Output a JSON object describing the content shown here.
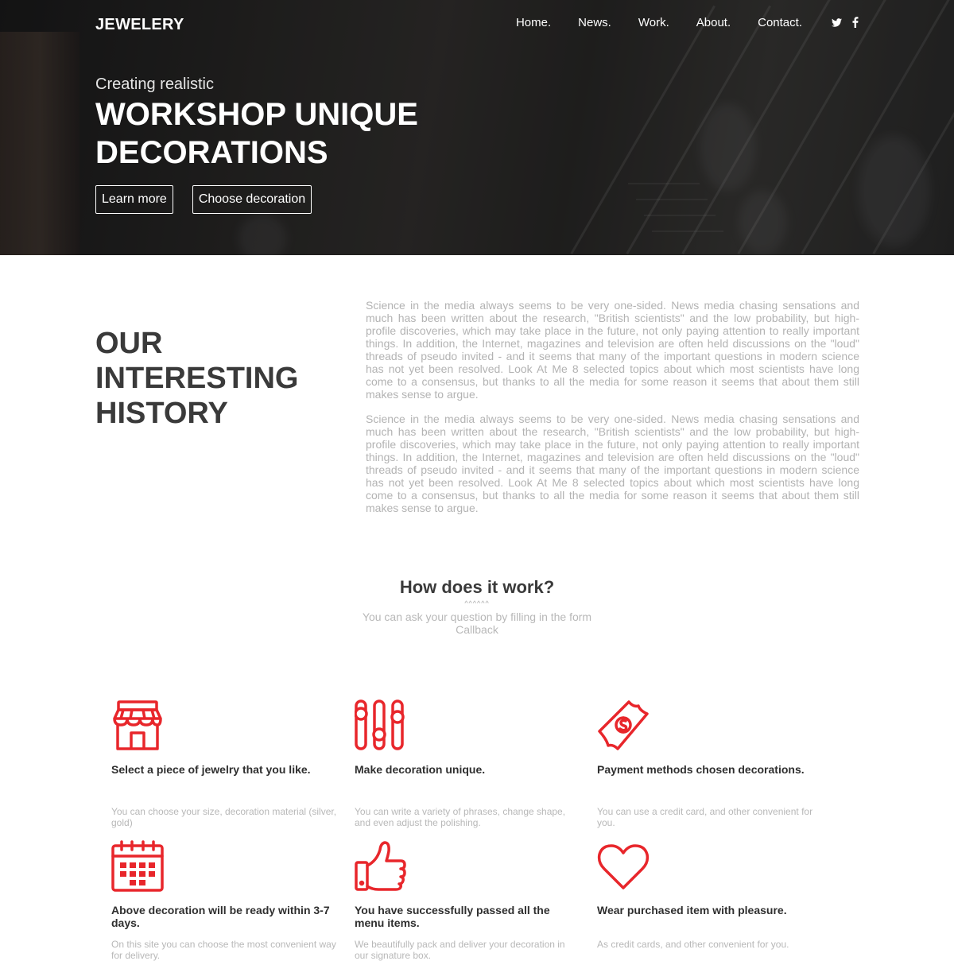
{
  "header": {
    "logo": "JEWELERY",
    "nav": [
      "Home.",
      "News.",
      "Work.",
      "About.",
      "Contact."
    ],
    "social": [
      "twitter-icon",
      "facebook-icon"
    ]
  },
  "hero": {
    "subtitle": "Creating realistic",
    "title": "WORKSHOP UNIQUE DECORATIONS",
    "buttons": [
      "Learn more",
      "Choose decoration"
    ]
  },
  "history": {
    "title": "OUR INTERESTING HISTORY",
    "paragraphs": [
      "Science in the media always seems to be very one-sided. News media chasing sensations and much has been written about the research, \"British scientists\" and the low probability, but high-profile discoveries, which may take place in the future, not only paying attention to really important things. In addition, the Internet, magazines and television are often held discussions on the \"loud\" threads of pseudo invited - and it seems that many of the important questions in modern science has not yet been resolved. Look At Me 8 selected topics about which most scientists have long come to a consensus, but thanks to all the media for some reason it seems that about them still makes sense to argue.",
      "Science in the media always seems to be very one-sided. News media chasing sensations and much has been written about the research, \"British scientists\" and the low probability, but high-profile discoveries, which may take place in the future, not only paying attention to really important things. In addition, the Internet, magazines and television are often held discussions on the \"loud\" threads of pseudo invited - and it seems that many of the important questions in modern science has not yet been resolved. Look At Me 8 selected topics about which most scientists have long come to a consensus, but thanks to all the media for some reason it seems that about them still makes sense to argue."
    ]
  },
  "how": {
    "title": "How does it work?",
    "deco": "^^^^^^",
    "subtitle": "You can ask your question by filling in the form Callback"
  },
  "features": [
    {
      "icon": "shop-icon",
      "title": "Select a piece of jewelry that you like.",
      "text": "You can choose your size, decoration material (silver, gold)"
    },
    {
      "icon": "sliders-icon",
      "title": "Make decoration unique.",
      "text": "You can write a variety of phrases, change shape, and even adjust the polishing."
    },
    {
      "icon": "money-icon",
      "title": "Payment methods chosen decorations.",
      "text": "You can use a credit card, and other convenient for you."
    },
    {
      "icon": "calendar-icon",
      "title": "Above decoration will be ready within 3-7 days.",
      "text": "On this site you can choose the most convenient way for delivery."
    },
    {
      "icon": "thumbs-up-icon",
      "title": "You have successfully passed all the menu items.",
      "text": "We beautifully pack and deliver your decoration in our signature box."
    },
    {
      "icon": "heart-icon",
      "title": "Wear purchased item with pleasure.",
      "text": "As credit cards, and other convenient for you."
    }
  ],
  "colors": {
    "accent": "#e8262b",
    "hero_overlay": "#2a2928"
  }
}
